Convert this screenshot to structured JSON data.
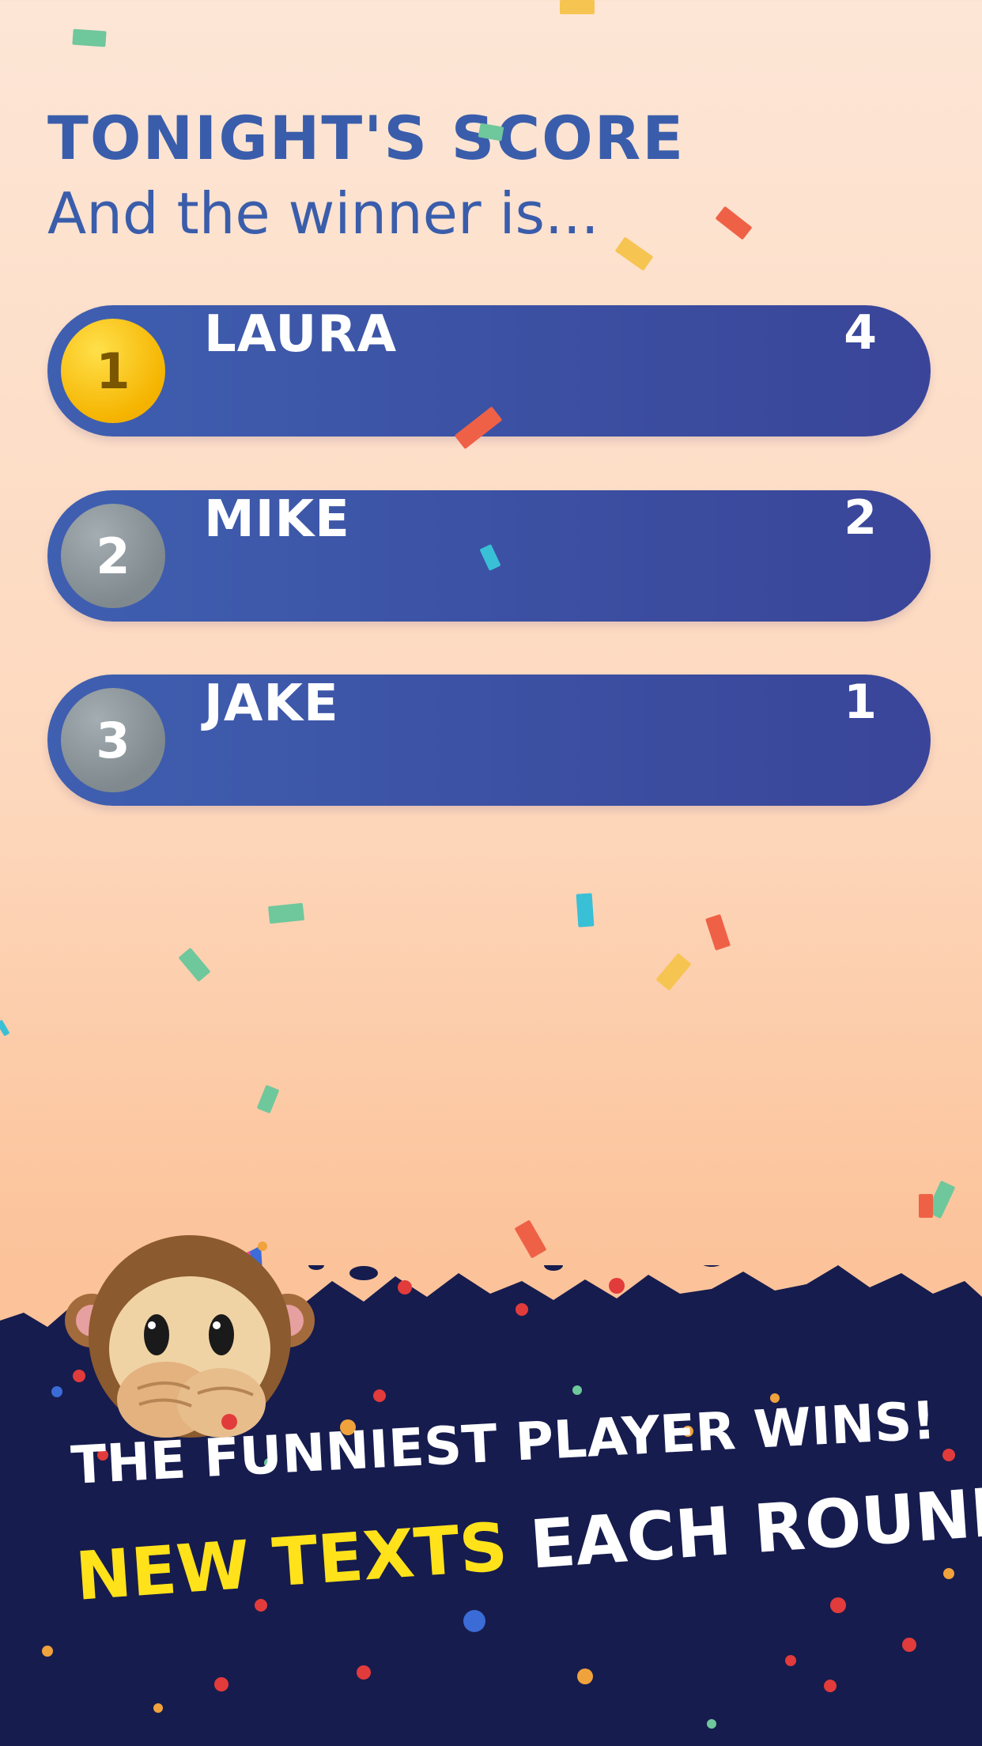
{
  "header": {
    "title": "TONIGHT'S SCORE",
    "subtitle": "And the winner is..."
  },
  "leaderboard": [
    {
      "rank": "1",
      "name": "LAURA",
      "score": "4",
      "medal": "gold"
    },
    {
      "rank": "2",
      "name": "MIKE",
      "score": "2",
      "medal": "silver"
    },
    {
      "rank": "3",
      "name": "JAKE",
      "score": "1",
      "medal": "silver"
    }
  ],
  "promo": {
    "line1": "THE FUNNIEST PLAYER WINS!",
    "line2_highlight": "NEW TEXTS",
    "line2_rest": " EACH ROUND",
    "highlight_color": "#ffe21a"
  },
  "icons": [
    "monkey-emoji-icon",
    "party-hat-icon",
    "confetti"
  ],
  "colors": {
    "accent": "#3a5dab",
    "row_bg": "#3b4c9f",
    "bottom_bg": "#161c4e",
    "gold": "#f5b400",
    "silver": "#7f898e"
  }
}
